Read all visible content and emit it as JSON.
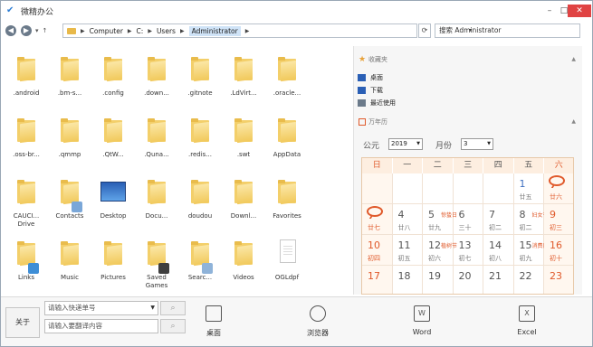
{
  "window": {
    "title": "微精办公",
    "controls": {
      "minimize": "–",
      "maximize": "□",
      "close": "✕"
    }
  },
  "nav": {
    "back": "◀",
    "forward": "▶",
    "down": "▾",
    "up": "↑",
    "breadcrumbs": [
      "Computer",
      "C:",
      "Users",
      "Administrator"
    ],
    "refresh": "⟳",
    "search_placeholder": "搜索 Administrator"
  },
  "files": [
    {
      "label": ".android",
      "icon": "folder-icon"
    },
    {
      "label": ".bm-s...",
      "icon": "folder-icon"
    },
    {
      "label": ".config",
      "icon": "folder-icon"
    },
    {
      "label": ".down...",
      "icon": "folder-icon"
    },
    {
      "label": ".gitnote",
      "icon": "folder-icon"
    },
    {
      "label": ".LdVirt...",
      "icon": "folder-icon"
    },
    {
      "label": ".oracle...",
      "icon": "folder-icon"
    },
    {
      "label": ".oss-br...",
      "icon": "folder-icon"
    },
    {
      "label": ".qmmp",
      "icon": "folder-icon"
    },
    {
      "label": ".QtW...",
      "icon": "folder-icon"
    },
    {
      "label": ".Quna...",
      "icon": "folder-icon"
    },
    {
      "label": ".redis...",
      "icon": "folder-icon"
    },
    {
      "label": ".swt",
      "icon": "folder-icon"
    },
    {
      "label": "AppData",
      "icon": "folder-icon"
    },
    {
      "label": "CAUCI... Drive",
      "icon": "folder-icon"
    },
    {
      "label": "Contacts",
      "icon": "contacts-folder-icon"
    },
    {
      "label": "Desktop",
      "icon": "desktop-icon"
    },
    {
      "label": "Docu...",
      "icon": "folder-icon"
    },
    {
      "label": "doudou",
      "icon": "folder-icon"
    },
    {
      "label": "Downl...",
      "icon": "folder-icon"
    },
    {
      "label": "Favorites",
      "icon": "folder-icon"
    },
    {
      "label": "Links",
      "icon": "links-folder-icon"
    },
    {
      "label": "Music",
      "icon": "folder-icon"
    },
    {
      "label": "Pictures",
      "icon": "folder-icon"
    },
    {
      "label": "Saved Games",
      "icon": "saved-games-folder-icon"
    },
    {
      "label": "Searc...",
      "icon": "search-folder-icon"
    },
    {
      "label": "Videos",
      "icon": "folder-icon"
    },
    {
      "label": "OGLdpf",
      "icon": "file-icon"
    }
  ],
  "favorites": {
    "header": "收藏夹",
    "items": [
      {
        "label": "桌面",
        "icon": "desktop-icon",
        "color": "#2a5fb5"
      },
      {
        "label": "下载",
        "icon": "download-icon",
        "color": "#2a5fb5"
      },
      {
        "label": "最近使用",
        "icon": "recent-icon",
        "color": "#6b7a8a"
      }
    ]
  },
  "calendar": {
    "header": "万年历",
    "era_label": "公元",
    "year": "2019",
    "month_label": "月份",
    "month": "3",
    "weekdays": [
      "日",
      "一",
      "二",
      "三",
      "四",
      "五",
      "六"
    ],
    "rows": [
      [
        {
          "d": "",
          "l": ""
        },
        {
          "d": "",
          "l": ""
        },
        {
          "d": "",
          "l": ""
        },
        {
          "d": "",
          "l": ""
        },
        {
          "d": "",
          "l": ""
        },
        {
          "d": "1",
          "l": "廿五"
        },
        {
          "d": "2",
          "l": "廿六",
          "bubble": true
        }
      ],
      [
        {
          "d": "3",
          "l": "廿七",
          "bubble": true
        },
        {
          "d": "4",
          "l": "廿八"
        },
        {
          "d": "5",
          "l": "廿九",
          "fest": "惊蛰日"
        },
        {
          "d": "6",
          "l": "三十"
        },
        {
          "d": "7",
          "l": "初二"
        },
        {
          "d": "8",
          "l": "初二",
          "fest": "妇女节"
        },
        {
          "d": "9",
          "l": "初三"
        }
      ],
      [
        {
          "d": "10",
          "l": "初四"
        },
        {
          "d": "11",
          "l": "初五"
        },
        {
          "d": "12",
          "l": "初六",
          "fest": "植树节"
        },
        {
          "d": "13",
          "l": "初七"
        },
        {
          "d": "14",
          "l": "初八"
        },
        {
          "d": "15",
          "l": "初九",
          "fest": "消费日"
        },
        {
          "d": "16",
          "l": "初十"
        }
      ],
      [
        {
          "d": "17",
          "l": ""
        },
        {
          "d": "18",
          "l": ""
        },
        {
          "d": "19",
          "l": ""
        },
        {
          "d": "20",
          "l": ""
        },
        {
          "d": "21",
          "l": ""
        },
        {
          "d": "22",
          "l": ""
        },
        {
          "d": "23",
          "l": ""
        }
      ]
    ]
  },
  "bottom": {
    "toggle_label": "关于",
    "express_placeholder": "请输入快递单号",
    "translate_placeholder": "请输入要翻译内容",
    "tools": [
      {
        "label": "桌面",
        "icon": "monitor-icon"
      },
      {
        "label": "浏览器",
        "icon": "compass-icon"
      },
      {
        "label": "Word",
        "icon": "word-icon"
      },
      {
        "label": "Excel",
        "icon": "excel-icon"
      }
    ]
  },
  "colors": {
    "accent": "#e05a2b",
    "folder": "#f3cf6a",
    "close": "#e04343"
  }
}
